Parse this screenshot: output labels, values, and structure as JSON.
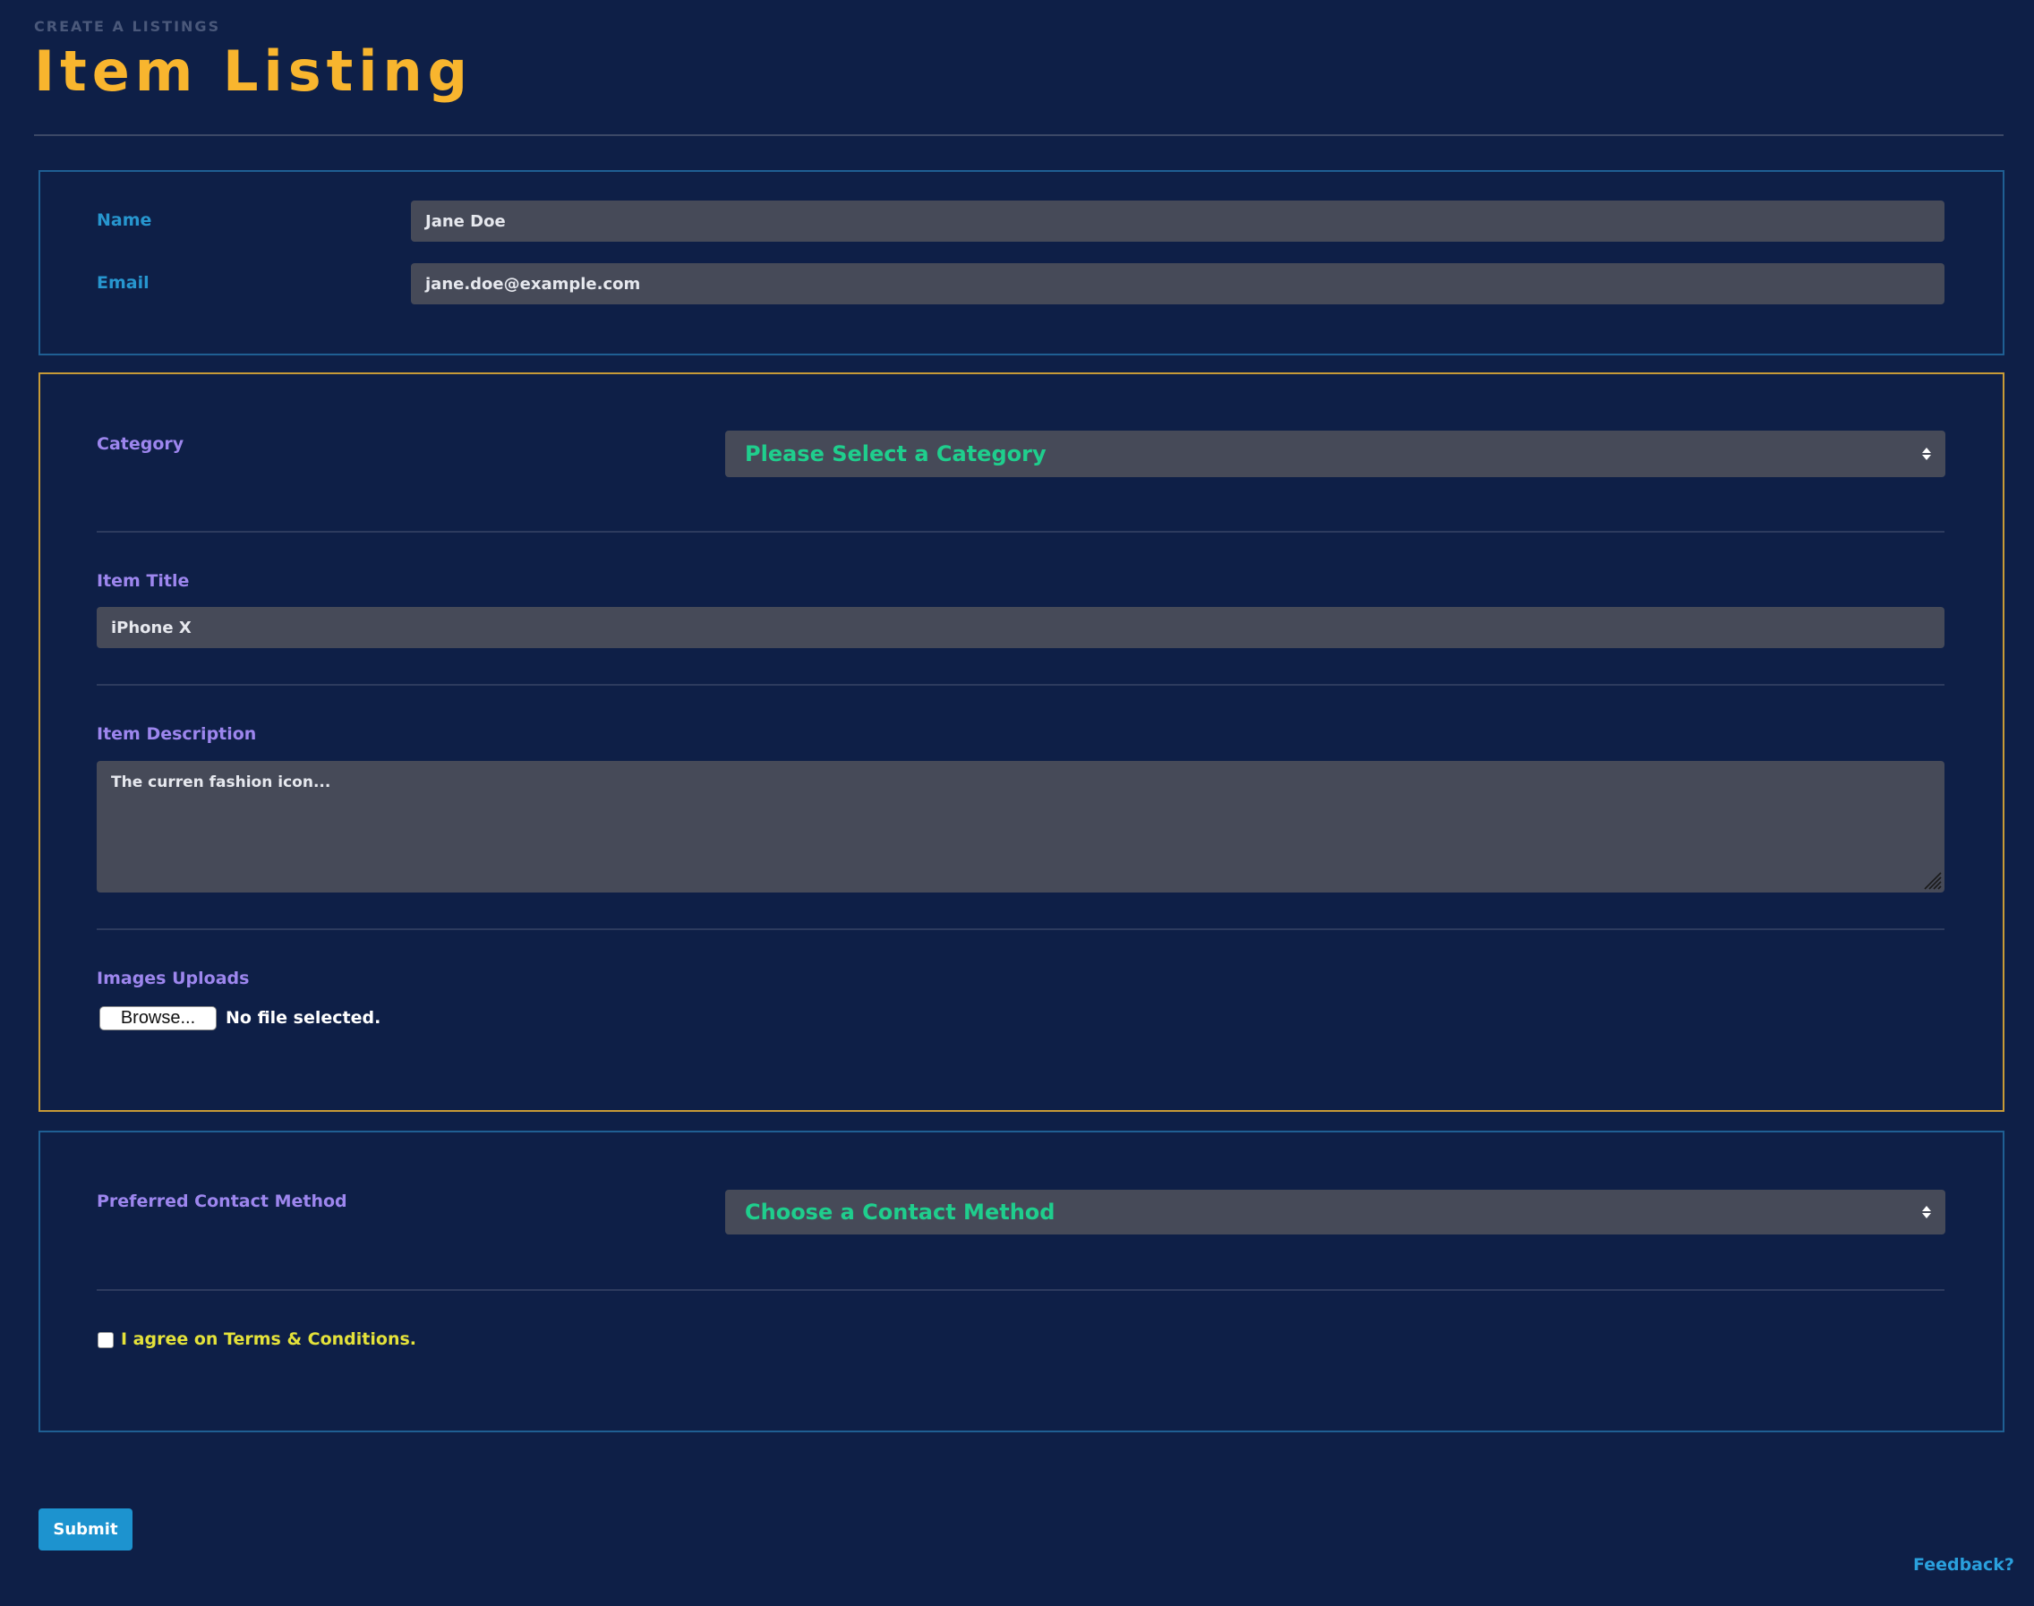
{
  "header": {
    "eyebrow": "CREATE A LISTINGS",
    "title": "Item Listing"
  },
  "contact_section": {
    "name_label": "Name",
    "name_value": "Jane Doe",
    "email_label": "Email",
    "email_value": "jane.doe@example.com"
  },
  "item_section": {
    "category_label": "Category",
    "category_selected": "Please Select a Category",
    "title_label": "Item Title",
    "title_value": "iPhone X",
    "description_label": "Item Description",
    "description_value": "The curren fashion icon...",
    "images_label": "Images Uploads",
    "browse_label": "Browse...",
    "file_status": "No file selected."
  },
  "preferences_section": {
    "contact_method_label": "Preferred Contact Method",
    "contact_method_selected": "Choose a Contact Method",
    "terms_label": "I agree on Terms & Conditions.",
    "terms_checked": false
  },
  "actions": {
    "submit_label": "Submit",
    "feedback_label": "Feedback?"
  },
  "colors": {
    "background": "#0e1f47",
    "title_accent": "#f8b52e",
    "label_cyan": "#2796cf",
    "label_violet": "#9d86ee",
    "select_text": "#1fce8d",
    "terms_text": "#e4e23a",
    "submit_button": "#1d93cf",
    "field_background": "#464a58"
  }
}
